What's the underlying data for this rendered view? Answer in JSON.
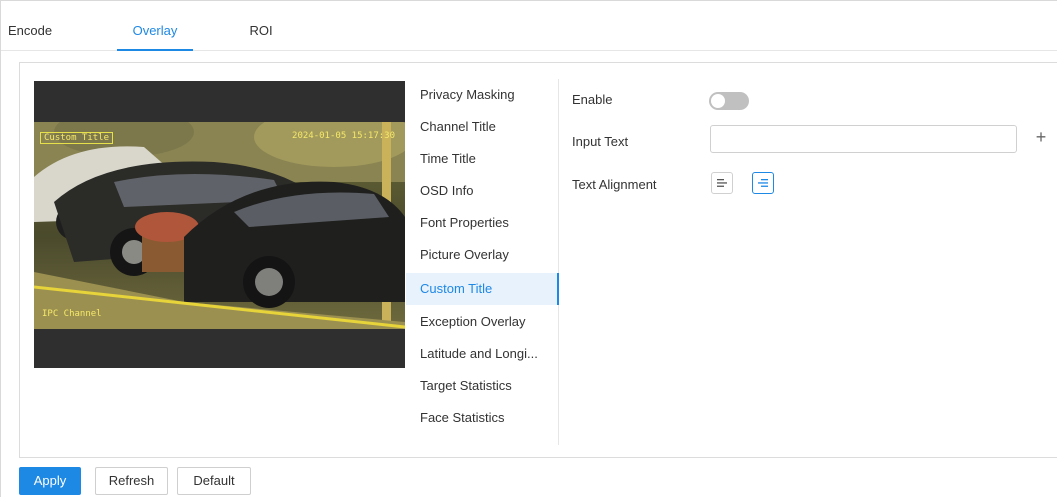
{
  "tabs": [
    {
      "label": "Encode",
      "active": false
    },
    {
      "label": "Overlay",
      "active": true
    },
    {
      "label": "ROI",
      "active": false
    }
  ],
  "preview": {
    "osd_channel": "Custom Title",
    "osd_time": "2024-01-05 15:17:30",
    "osd_bottom": "IPC Channel"
  },
  "submenu": {
    "items": [
      {
        "label": "Privacy Masking"
      },
      {
        "label": "Channel Title"
      },
      {
        "label": "Time Title"
      },
      {
        "label": "OSD Info"
      },
      {
        "label": "Font Properties"
      },
      {
        "label": "Picture Overlay"
      },
      {
        "label": "Custom Title",
        "active": true
      },
      {
        "label": "Exception Overlay"
      },
      {
        "label": "Latitude and Longi..."
      },
      {
        "label": "Target Statistics"
      },
      {
        "label": "Face Statistics"
      }
    ]
  },
  "form": {
    "enable_label": "Enable",
    "enable_state": false,
    "input_text_label": "Input Text",
    "input_text_value": "",
    "add_symbol": "+",
    "alignment_label": "Text Alignment",
    "alignment_selected": "right"
  },
  "footer": {
    "apply": "Apply",
    "refresh": "Refresh",
    "default": "Default"
  },
  "colors": {
    "accent": "#1e88e5",
    "toggle_off": "#c0c0c0",
    "active_menu_bg": "#e7f2fd",
    "osd_text": "#f5e86a"
  }
}
